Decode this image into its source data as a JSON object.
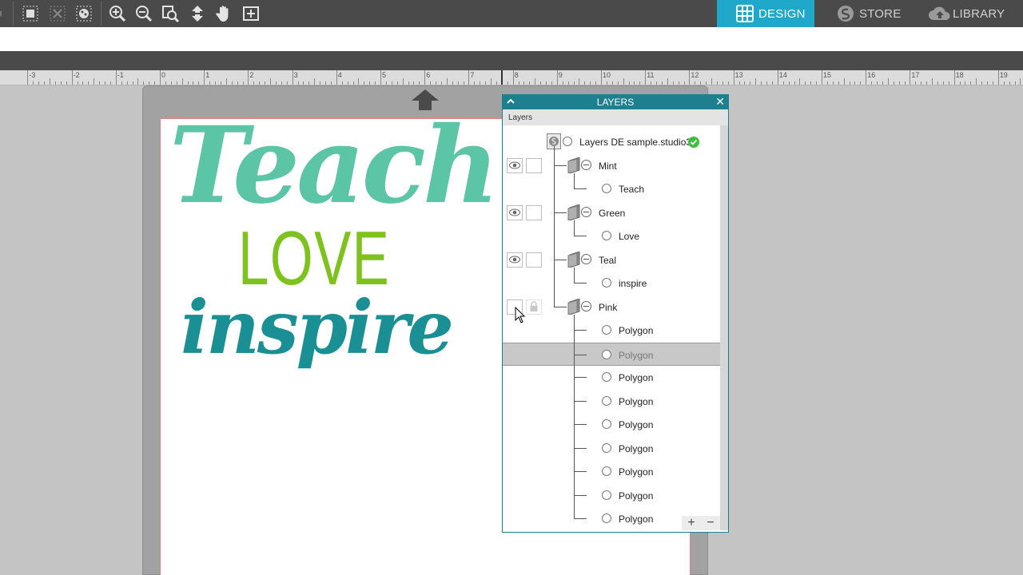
{
  "toolbar": {
    "tools": [
      {
        "name": "group-icon"
      },
      {
        "name": "ungroup-icon"
      },
      {
        "name": "compound-path-icon"
      },
      {
        "name": "zoom-in-icon"
      },
      {
        "name": "zoom-out-icon"
      },
      {
        "name": "zoom-fit-icon"
      },
      {
        "name": "move-down-icon"
      },
      {
        "name": "pan-hand-icon"
      },
      {
        "name": "fit-to-page-icon"
      }
    ],
    "tabs": {
      "design": "DESIGN",
      "store": "STORE",
      "library": "LIBRARY"
    },
    "active_tab": "design",
    "accent_color": "#1fa8c9"
  },
  "ruler": {
    "labels": [
      "-3",
      "-2",
      "-1",
      "0",
      "1",
      "2",
      "3",
      "4",
      "5",
      "6",
      "7",
      "8",
      "9",
      "10",
      "11",
      "12",
      "13",
      "14",
      "15",
      "16",
      "17",
      "18",
      "19"
    ]
  },
  "canvas": {
    "words": {
      "teach": "Teach",
      "love": "LOVE",
      "inspire": "inspire"
    },
    "colors": {
      "mint": "#5cc5a5",
      "green": "#7dc21e",
      "teal": "#1a9094"
    }
  },
  "layers_panel": {
    "title": "LAYERS",
    "subheader": "Layers",
    "document": {
      "label": "Layers DE sample.studio3",
      "status": "check-icon"
    },
    "groups": [
      {
        "label": "Mint",
        "visible": true,
        "children": [
          "Teach"
        ]
      },
      {
        "label": "Green",
        "visible": true,
        "children": [
          "Love"
        ]
      },
      {
        "label": "Teal",
        "visible": true,
        "children": [
          "inspire"
        ]
      },
      {
        "label": "Pink",
        "visible": false,
        "locked": true,
        "children": [
          "Polygon",
          "Polygon",
          "Polygon",
          "Polygon",
          "Polygon",
          "Polygon",
          "Polygon",
          "Polygon",
          "Polygon"
        ]
      }
    ],
    "selected_child": {
      "group": "Pink",
      "index": 1
    },
    "footer": {
      "add": "+",
      "remove": "−"
    },
    "header_color": "#1e7f8f"
  }
}
